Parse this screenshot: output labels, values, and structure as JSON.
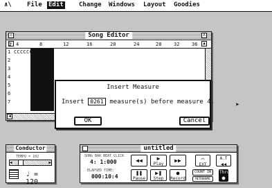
{
  "menubar": {
    "apple_symbol": "∧\\",
    "items": [
      {
        "label": "File"
      },
      {
        "label": "Edit"
      },
      {
        "label": "Change"
      },
      {
        "label": "Windows"
      },
      {
        "label": "Layout"
      },
      {
        "label": "Goodies"
      }
    ],
    "active_index": 1
  },
  "song_editor": {
    "title": "Song Editor",
    "ruler_ticks": [
      "1",
      "4",
      "8",
      "12",
      "16",
      "20",
      "24",
      "28",
      "32",
      "36"
    ],
    "track_numbers": [
      "1",
      "2",
      "3",
      "4",
      "5",
      "6",
      "7"
    ],
    "track1_data": "CCCCCCCCCCCCC"
  },
  "dialog": {
    "title": "Insert Measure",
    "text_before": "Insert",
    "measure_count": "0261",
    "text_after": "measure(s) before measure 4.",
    "ok_label": "OK",
    "cancel_label": "Cancel"
  },
  "conductor": {
    "title": "Conductor",
    "tempo_label": "TEMPO = 102",
    "tempo_display": "♩ = 120"
  },
  "transport": {
    "title": "untitled",
    "display_label": "SONG BAR BEAT CLICK",
    "position": "4: 1:000",
    "elapsed_label": "ELAPSED TIME:",
    "elapsed_time": "000:10:4",
    "buttons": {
      "rewind": "◀◀",
      "play": "Play",
      "fast_forward": "▶▶",
      "pause": "Pause",
      "step": "Step",
      "record": "Record",
      "count_in": "COUNT IN",
      "metronome": "METRONOME",
      "ext": "EXT",
      "thru": "Thru"
    }
  }
}
